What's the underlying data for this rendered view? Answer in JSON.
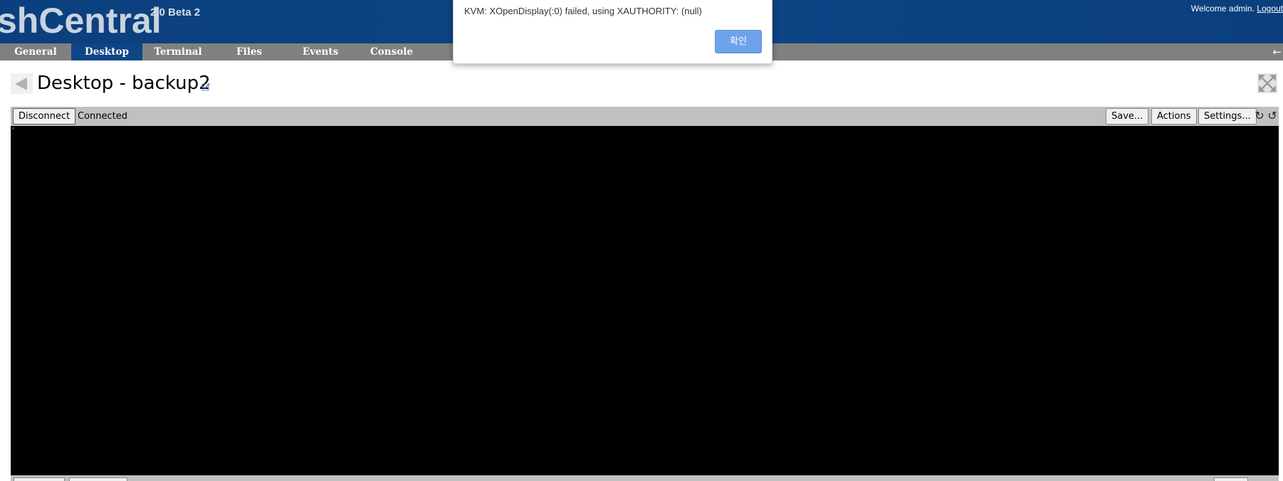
{
  "header": {
    "app_title": "shCentral",
    "version": "2.0 Beta 2",
    "welcome_text": "Welcome admin.",
    "logout_label": "Logout"
  },
  "tabs": [
    {
      "label": "General",
      "active": false
    },
    {
      "label": "Desktop",
      "active": true
    },
    {
      "label": "Terminal",
      "active": false
    },
    {
      "label": "Files",
      "active": false
    },
    {
      "label": "Events",
      "active": false
    },
    {
      "label": "Console",
      "active": false
    }
  ],
  "tab_bar_arrow": "←",
  "page": {
    "title": "Desktop - backup2",
    "icons": [
      "back-arrow-icon",
      "edit-icon",
      "fullscreen-icon"
    ]
  },
  "toolbar": {
    "disconnect_label": "Disconnect",
    "status": "Connected",
    "save_label": "Save...",
    "actions_label": "Actions",
    "settings_label": "Settings...",
    "rotate_cw_glyph": "↻",
    "rotate_ccw_glyph": "↺"
  },
  "alert": {
    "message": "KVM: XOpenDisplay(:0) failed, using XAUTHORITY: (null)",
    "ok_label": "확인"
  },
  "colors": {
    "header_bg": "#0e4586",
    "tab_bar_bg": "#808080",
    "active_tab_bg": "#0e4586",
    "toolbar_bg": "#c0c0c0",
    "remote_screen_bg": "#000000",
    "alert_button": "#6ea2ea"
  }
}
